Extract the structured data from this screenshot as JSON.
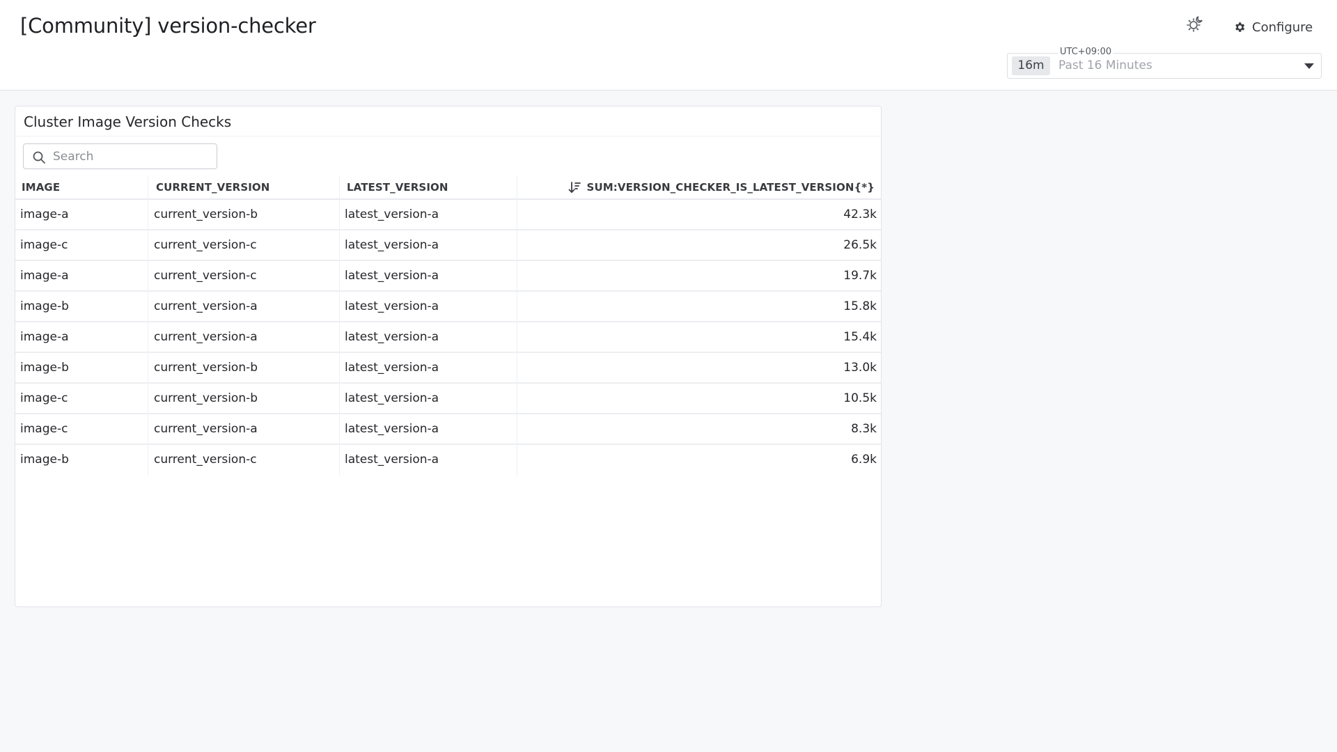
{
  "header": {
    "title": "[Community] version-checker",
    "theme_icon": "sun-moon-icon",
    "configure_label": "Configure",
    "configure_icon": "gear-icon",
    "timezone": "UTC+09:00",
    "time_badge": "16m",
    "time_range": "Past 16 Minutes"
  },
  "widget": {
    "title": "Cluster Image Version Checks",
    "search_placeholder": "Search",
    "columns": {
      "image": "IMAGE",
      "current": "CURRENT_VERSION",
      "latest": "LATEST_VERSION",
      "sum": "SUM:VERSION_CHECKER_IS_LATEST_VERSION{*}"
    },
    "sort": "descending by SUM:VERSION_CHECKER_IS_LATEST_VERSION{*}",
    "rows": [
      {
        "image": "image-a",
        "current": "current_version-b",
        "latest": "latest_version-a",
        "sum": "42.3k"
      },
      {
        "image": "image-c",
        "current": "current_version-c",
        "latest": "latest_version-a",
        "sum": "26.5k"
      },
      {
        "image": "image-a",
        "current": "current_version-c",
        "latest": "latest_version-a",
        "sum": "19.7k"
      },
      {
        "image": "image-b",
        "current": "current_version-a",
        "latest": "latest_version-a",
        "sum": "15.8k"
      },
      {
        "image": "image-a",
        "current": "current_version-a",
        "latest": "latest_version-a",
        "sum": "15.4k"
      },
      {
        "image": "image-b",
        "current": "current_version-b",
        "latest": "latest_version-a",
        "sum": "13.0k"
      },
      {
        "image": "image-c",
        "current": "current_version-b",
        "latest": "latest_version-a",
        "sum": "10.5k"
      },
      {
        "image": "image-c",
        "current": "current_version-a",
        "latest": "latest_version-a",
        "sum": "8.3k"
      },
      {
        "image": "image-b",
        "current": "current_version-c",
        "latest": "latest_version-a",
        "sum": "6.9k"
      }
    ]
  },
  "colors": {
    "background": "#f7f8fa",
    "panel": "#ffffff",
    "border": "#e1e3e8",
    "text": "#26262b",
    "muted": "#a0a3aa"
  }
}
